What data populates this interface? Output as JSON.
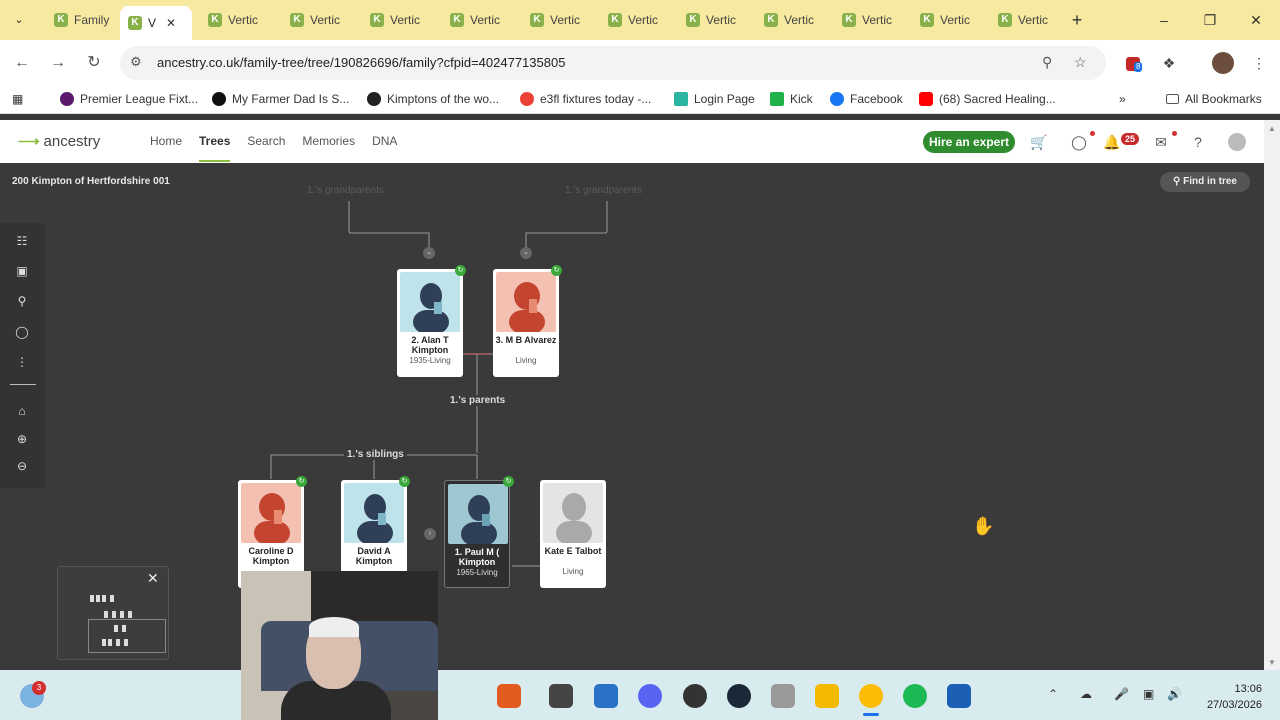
{
  "browser": {
    "tabs": [
      {
        "label": "Family"
      },
      {
        "label": "V",
        "active": true
      },
      {
        "label": "Vertic"
      },
      {
        "label": "Vertic"
      },
      {
        "label": "Vertic"
      },
      {
        "label": "Vertic"
      },
      {
        "label": "Vertic"
      },
      {
        "label": "Vertic"
      },
      {
        "label": "Vertic"
      },
      {
        "label": "Vertic"
      },
      {
        "label": "Vertic"
      },
      {
        "label": "Vertic"
      },
      {
        "label": "Vertic"
      }
    ],
    "url": "ancestry.co.uk/family-tree/tree/190826696/family?cfpid=402477135805",
    "extension_badge": "8",
    "bookmarks": [
      {
        "label": "Premier League Fixt..."
      },
      {
        "label": "My Farmer Dad Is S..."
      },
      {
        "label": "Kimptons of the wo..."
      },
      {
        "label": "e3fl fixtures today -..."
      },
      {
        "label": "Login Page"
      },
      {
        "label": "Kick"
      },
      {
        "label": "Facebook"
      },
      {
        "label": "(68) Sacred Healing..."
      }
    ],
    "all_bookmarks": "All Bookmarks"
  },
  "site": {
    "logo": "ancestry",
    "nav": [
      "Home",
      "Trees",
      "Search",
      "Memories",
      "DNA"
    ],
    "active_nav": "Trees",
    "hire_button": "Hire an expert",
    "notification_count": "25",
    "brand_green": "#2e8b2e"
  },
  "tree": {
    "name": "200 Kimpton of Hertfordshire 001",
    "find_button": "Find in tree",
    "grandparents_label_left": "1.'s grandparents",
    "grandparents_label_right": "1.'s grandparents",
    "parents_label": "1.'s parents",
    "siblings_label": "1.'s siblings",
    "father": {
      "name": "2. Alan T Kimpton",
      "dates": "1935-Living"
    },
    "mother": {
      "name": "3. M B Alvarez",
      "dates": "Living"
    },
    "siblings": [
      {
        "name": "Caroline D Kimpton",
        "dates": ""
      },
      {
        "name": "David A Kimpton",
        "dates": ""
      }
    ],
    "focus": {
      "name": "1. Paul M ( Kimpton",
      "dates": "1965-Living"
    },
    "spouse": {
      "name": "Kate E Talbot",
      "dates": "Living"
    }
  },
  "taskbar": {
    "notification_badge": "3",
    "time": "13:06",
    "date": "27/03/2026"
  }
}
